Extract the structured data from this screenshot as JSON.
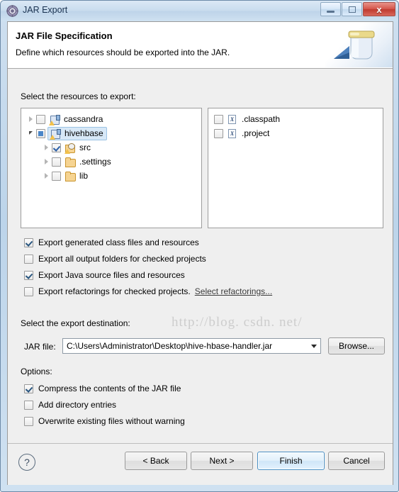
{
  "window": {
    "title": "JAR Export",
    "app_icon": "gear-circle-icon",
    "buttons": {
      "minimize": "minimize-icon",
      "maximize": "maximize-icon",
      "close": "x"
    }
  },
  "banner": {
    "title": "JAR File Specification",
    "subtitle": "Define which resources should be exported into the JAR.",
    "art_icon": "jar-export-icon"
  },
  "resources": {
    "label": "Select the resources to export:",
    "tree": [
      {
        "label": "cassandra",
        "icon": "java-project-icon",
        "check": "unchecked",
        "twisty": "collapsed",
        "indent": 0,
        "selected": false
      },
      {
        "label": "hivehbase",
        "icon": "java-project-icon",
        "check": "partial",
        "twisty": "expanded",
        "indent": 0,
        "selected": true
      },
      {
        "label": "src",
        "icon": "source-folder-icon",
        "check": "checked",
        "twisty": "collapsed",
        "indent": 1,
        "selected": false
      },
      {
        "label": ".settings",
        "icon": "folder-icon",
        "check": "unchecked",
        "twisty": "collapsed",
        "indent": 1,
        "selected": false
      },
      {
        "label": "lib",
        "icon": "folder-icon",
        "check": "unchecked",
        "twisty": "collapsed",
        "indent": 1,
        "selected": false
      }
    ],
    "files": [
      {
        "label": ".classpath",
        "icon": "xml-file-icon",
        "check": "unchecked"
      },
      {
        "label": ".project",
        "icon": "xml-file-icon",
        "check": "unchecked"
      }
    ]
  },
  "export_options": [
    {
      "label": "Export generated class files and resources",
      "checked": true,
      "mnemonic_index": 17
    },
    {
      "label": "Export all output folders for checked projects",
      "checked": false,
      "mnemonic_index": 14
    },
    {
      "label": "Export Java source files and resources",
      "checked": true,
      "mnemonic_index": 12
    },
    {
      "label": "Export refactorings for checked projects.",
      "checked": false,
      "mnemonic_index": 1,
      "link": "Select refactorings..."
    }
  ],
  "destination": {
    "label": "Select the export destination:",
    "field_label": "JAR file:",
    "jar_path": "C:\\Users\\Administrator\\Desktop\\hive-hbase-handler.jar",
    "browse_label": "Browse...",
    "dropdown_icon": "chevron-down-icon"
  },
  "options": {
    "label": "Options:",
    "items": [
      {
        "label": "Compress the contents of the JAR file",
        "checked": true
      },
      {
        "label": "Add directory entries",
        "checked": false
      },
      {
        "label": "Overwrite existing files without warning",
        "checked": false
      }
    ]
  },
  "footer": {
    "help_icon": "?",
    "back_label": "< Back",
    "next_label": "Next >",
    "finish_label": "Finish",
    "cancel_label": "Cancel"
  },
  "watermark": "http://blog. csdn. net/",
  "colors": {
    "accent": "#4a90c4",
    "titlebar": "#c9dcee",
    "close_button": "#bf3a2f",
    "dialog_bg": "#efefef",
    "panel_bg": "#ffffff",
    "selection": "#d7e8f7"
  }
}
